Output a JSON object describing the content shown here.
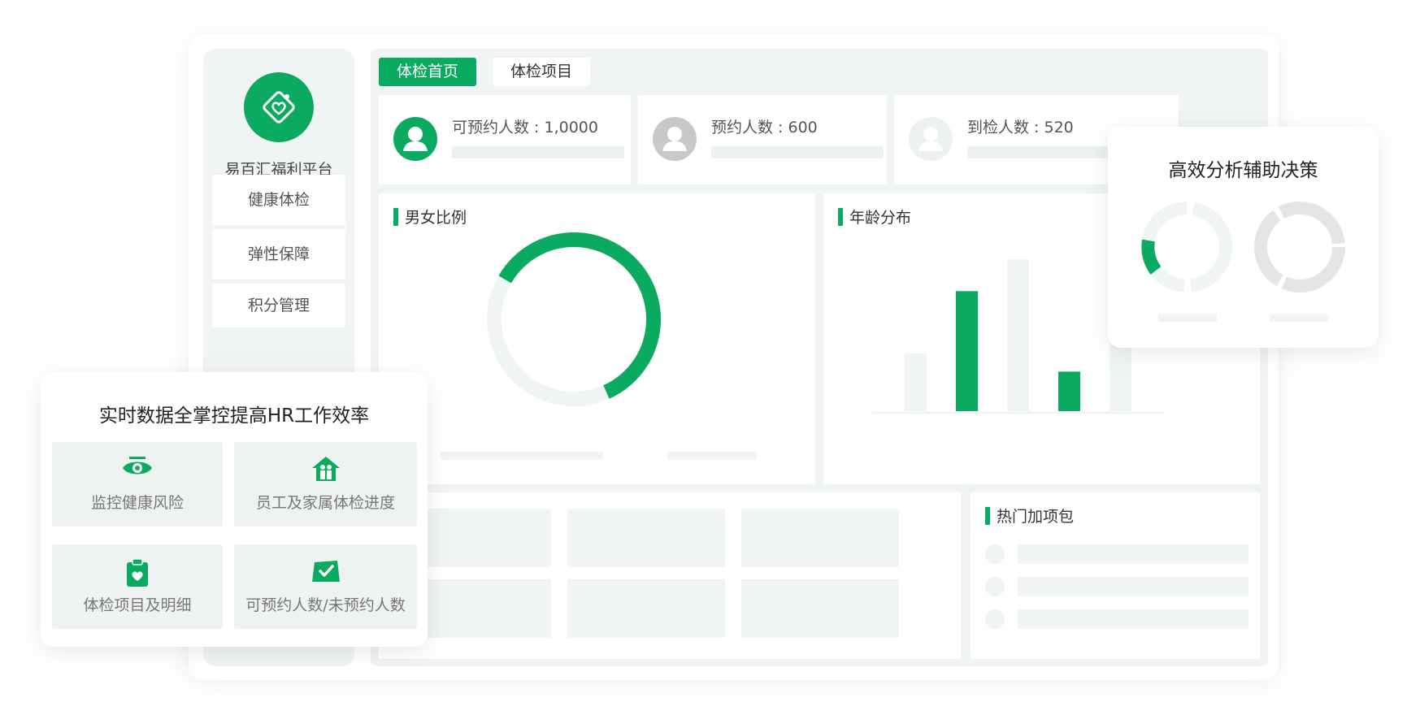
{
  "platform": {
    "name": "易百汇福利平台"
  },
  "sidebar": {
    "items": [
      {
        "label": "健康体检"
      },
      {
        "label": "弹性保障"
      },
      {
        "label": "积分管理"
      }
    ]
  },
  "tabs": [
    {
      "label": "体检首页",
      "active": true
    },
    {
      "label": "体检项目",
      "active": false
    }
  ],
  "stats": [
    {
      "label": "可预约人数 : 1,0000",
      "avatar_color": "#0aab60"
    },
    {
      "label": "预约人数 : 600",
      "avatar_color": "#c8c8c8"
    },
    {
      "label": "到检人数 : 520",
      "avatar_color": "#eef1f1"
    }
  ],
  "panels": {
    "gender_ratio": {
      "title": "男女比例"
    },
    "age_distribution": {
      "title": "年龄分布"
    },
    "hot_addons": {
      "title": "热门加项包"
    }
  },
  "chart_data": [
    {
      "type": "pie",
      "title": "",
      "values": [
        0.6,
        0.4
      ],
      "colors": [
        "#0aab60",
        "#f1f4f4"
      ]
    },
    {
      "type": "bar",
      "title": "",
      "values": [
        0.38,
        0.79,
        1.0,
        0.26,
        0.52
      ],
      "colors": [
        "#f1f4f4",
        "#0aab60",
        "#f1f4f4",
        "#0aab60",
        "#f1f4f4"
      ]
    }
  ],
  "overlay_left": {
    "title": "实时数据全掌控提高HR工作效率",
    "features": [
      {
        "label": "监控健康风险",
        "icon": "eye-icon"
      },
      {
        "label": "员工及家属体检进度",
        "icon": "family-home-icon"
      },
      {
        "label": "体检项目及明细",
        "icon": "clipboard-heart-icon"
      },
      {
        "label": "可预约人数/未预约人数",
        "icon": "calendar-check-icon"
      }
    ]
  },
  "overlay_right": {
    "title": "高效分析辅助决策"
  },
  "colors": {
    "accent": "#0aab60",
    "placeholder": "#f1f4f4",
    "gray": "#c8c8c8"
  }
}
